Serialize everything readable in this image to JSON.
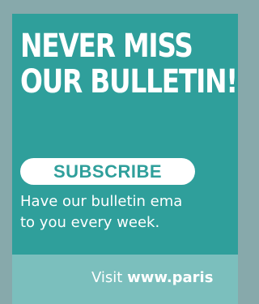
{
  "headline": {
    "line1": "NEVER MISS",
    "line2": "OUR BULLETIN!"
  },
  "subscribe_label": "SUBSCRIBE",
  "body": {
    "line1": "Have our bulletin ema",
    "line2": "to you every week."
  },
  "footer": {
    "prefix": "Visit ",
    "link": "www.paris"
  },
  "colors": {
    "frame": "#87a9ab",
    "card": "#2f9f9b",
    "footer": "#7bbfbd",
    "text": "#ffffff"
  }
}
